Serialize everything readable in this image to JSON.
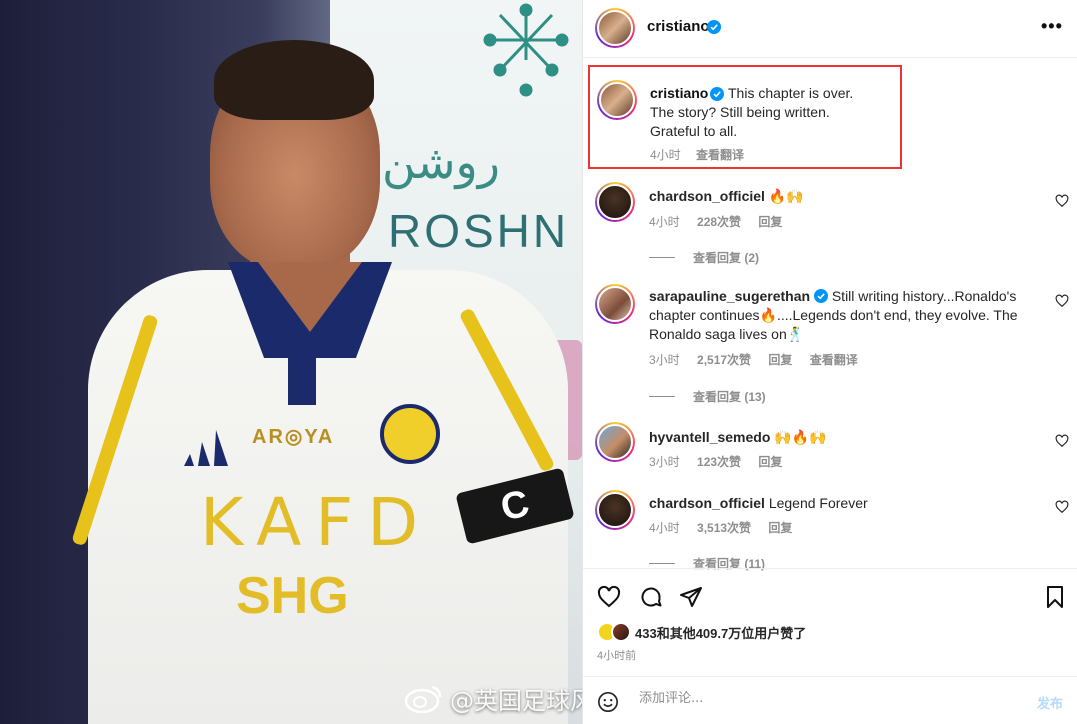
{
  "post": {
    "username": "cristiano",
    "more_label": "•••",
    "caption": {
      "username": "cristiano",
      "lines": [
        "This chapter is over.",
        "The story? Still being written.",
        "Grateful to all."
      ],
      "time": "4小时",
      "translate": "查看翻译"
    },
    "comments": [
      {
        "username": "chardson_officiel",
        "text": "🔥🙌",
        "time": "4小时",
        "likes": "228次赞",
        "reply": "回复",
        "view_replies": "查看回复 (2)"
      },
      {
        "username": "sarapauline_sugerethan",
        "text": "Still writing history...Ronaldo's chapter continues🔥....Legends don't end, they evolve. The Ronaldo saga lives on🕺",
        "time": "3小时",
        "likes": "2,517次赞",
        "reply": "回复",
        "translate": "查看翻译",
        "view_replies": "查看回复 (13)"
      },
      {
        "username": "hyvantell_semedo",
        "text": "🙌🔥🙌",
        "time": "3小时",
        "likes": "123次赞",
        "reply": "回复"
      },
      {
        "username": "chardson_officiel",
        "text": "Legend Forever",
        "time": "4小时",
        "likes": "3,513次赞",
        "reply": "回复",
        "view_replies": "查看回复 (11)"
      }
    ],
    "likes_text": "433和其他409.7万位用户赞了",
    "posted_time": "4小时前",
    "comment_placeholder": "添加评论...",
    "post_button": "发布"
  },
  "photo": {
    "sponsor_top": "AR◎YA",
    "sponsor_main": "KAFD",
    "sponsor_bottom": "SHG",
    "backdrop_arabic": "روشن",
    "backdrop_english": "ROSHN",
    "armband": "C"
  },
  "watermark": "@英国足球风向标",
  "colors": {
    "highlight_border": "#ee3333",
    "verified": "#0095f6",
    "jersey_gold": "#e2bd27",
    "jersey_navy": "#1b2a6b"
  }
}
